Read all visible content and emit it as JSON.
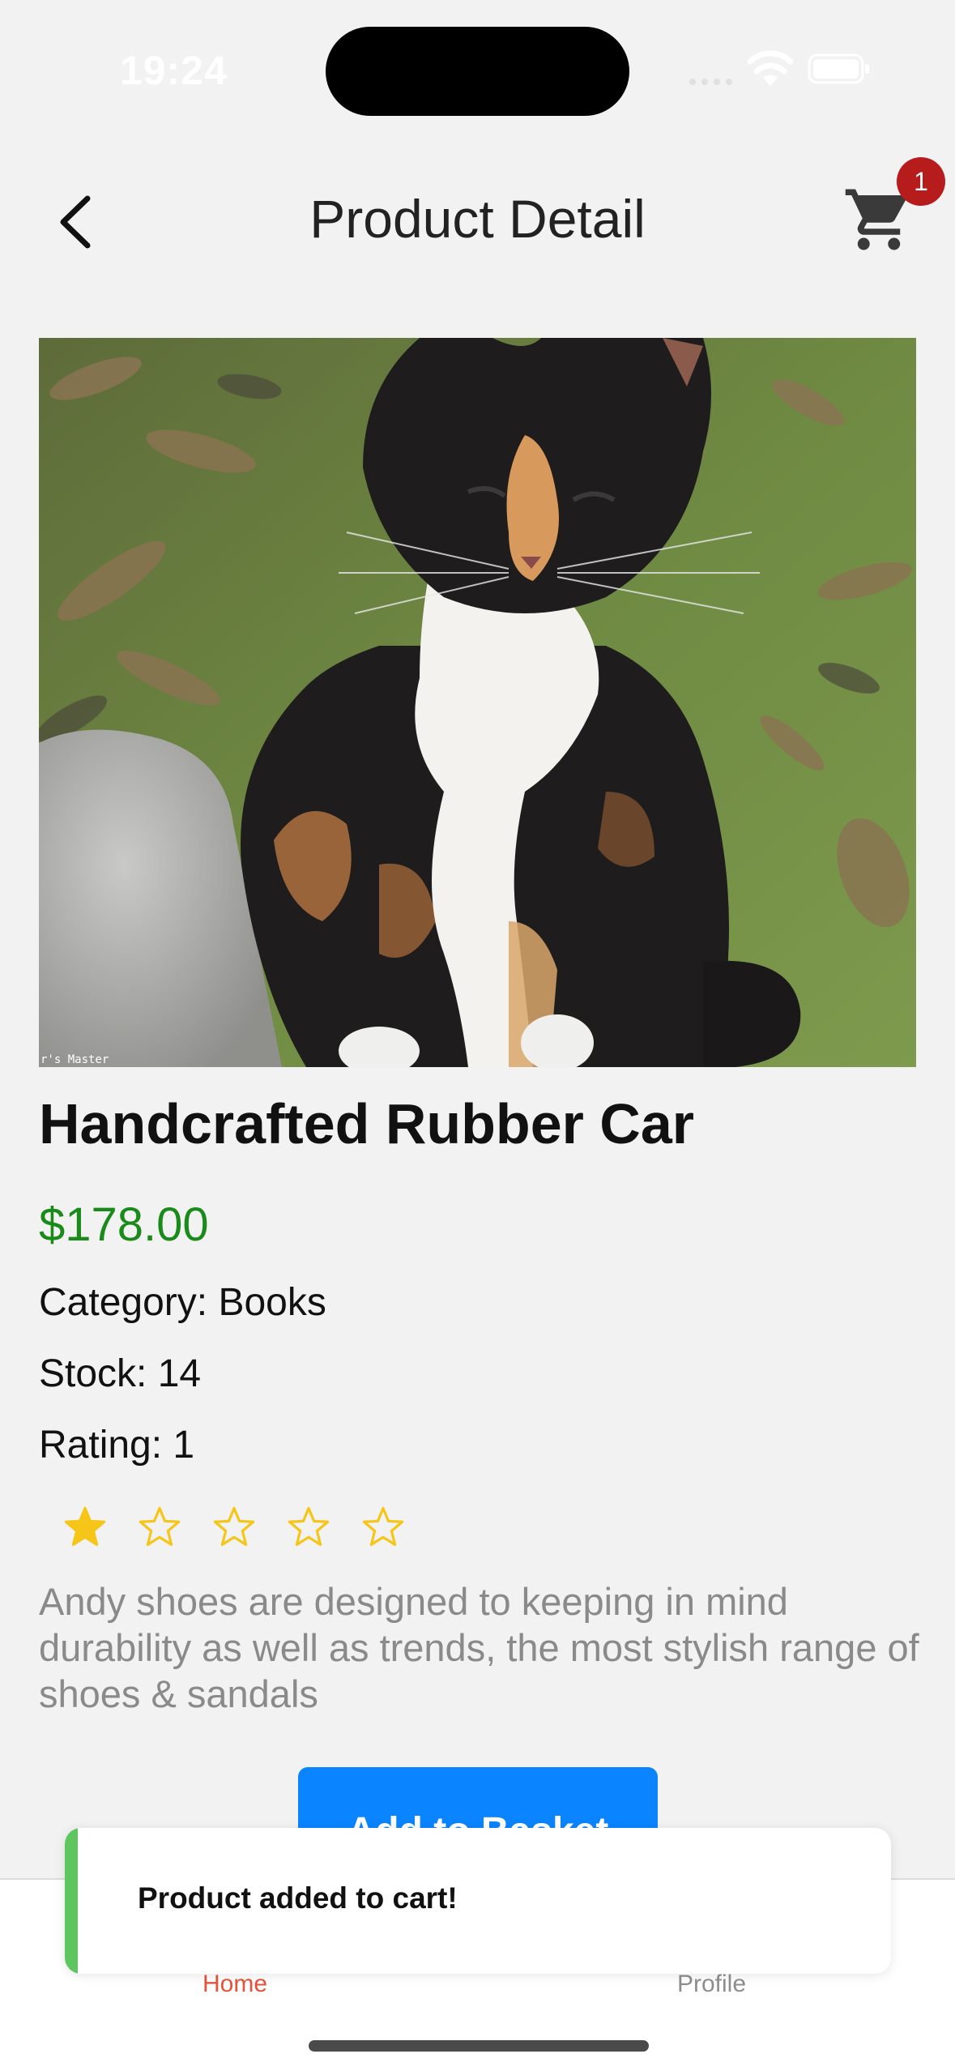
{
  "status_bar": {
    "time": "19:24"
  },
  "header": {
    "title": "Product Detail",
    "back_icon": "chevron-left-icon",
    "cart_icon": "cart-icon",
    "cart_count": "1"
  },
  "product": {
    "image_alt": "Calico cat photo",
    "image_caption": "r's Master",
    "name": "Handcrafted Rubber Car",
    "price": "$178.00",
    "category_line": "Category: Books",
    "stock_line": "Stock: 14",
    "rating_line": "Rating: 1",
    "rating_value": 1,
    "rating_max": 5,
    "description": "Andy shoes are designed to keeping in mind durability as well as trends, the most stylish range of shoes & sandals",
    "add_button_label": "Add to Basket"
  },
  "toast": {
    "message": "Product added to cart!"
  },
  "tabs": [
    {
      "label": "Home",
      "active": true
    },
    {
      "label": "Profile",
      "active": false
    }
  ],
  "colors": {
    "background": "#f2f2f2",
    "price": "#1a8a1a",
    "primary_button": "#0a84ff",
    "badge": "#b71c1c",
    "active_tab": "#e8533a",
    "star": "#f5c518",
    "toast_accent": "#5fc65f"
  }
}
